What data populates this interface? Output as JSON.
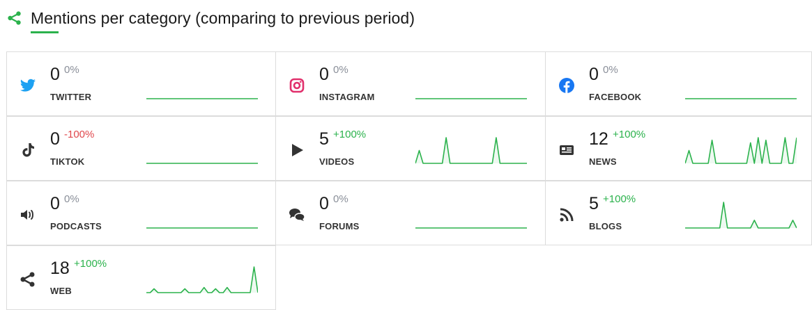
{
  "header": {
    "title": "Mentions per category (comparing to previous period)",
    "icon": "share-icon"
  },
  "colors": {
    "accent": "#2bb24c",
    "negative": "#e0474c",
    "neutral": "#8a8f99",
    "twitter": "#1da1f2",
    "instagram": "#e1306c",
    "facebook": "#1877f2",
    "icon_dark": "#333333"
  },
  "categories": [
    {
      "label": "TWITTER",
      "count": "0",
      "change": "0%",
      "trend": "neutral",
      "icon": "twitter-icon",
      "series": [
        0,
        0,
        0,
        0,
        0,
        0,
        0,
        0,
        0,
        0,
        0,
        0,
        0,
        0,
        0,
        0,
        0,
        0,
        0,
        0,
        0,
        0,
        0,
        0,
        0,
        0,
        0,
        0,
        0,
        0
      ]
    },
    {
      "label": "INSTAGRAM",
      "count": "0",
      "change": "0%",
      "trend": "neutral",
      "icon": "instagram-icon",
      "series": [
        0,
        0,
        0,
        0,
        0,
        0,
        0,
        0,
        0,
        0,
        0,
        0,
        0,
        0,
        0,
        0,
        0,
        0,
        0,
        0,
        0,
        0,
        0,
        0,
        0,
        0,
        0,
        0,
        0,
        0
      ]
    },
    {
      "label": "FACEBOOK",
      "count": "0",
      "change": "0%",
      "trend": "neutral",
      "icon": "facebook-icon",
      "series": [
        0,
        0,
        0,
        0,
        0,
        0,
        0,
        0,
        0,
        0,
        0,
        0,
        0,
        0,
        0,
        0,
        0,
        0,
        0,
        0,
        0,
        0,
        0,
        0,
        0,
        0,
        0,
        0,
        0,
        0
      ]
    },
    {
      "label": "TIKTOK",
      "count": "0",
      "change": "-100%",
      "trend": "neg",
      "icon": "tiktok-icon",
      "series": [
        0,
        0,
        0,
        0,
        0,
        0,
        0,
        0,
        0,
        0,
        0,
        0,
        0,
        0,
        0,
        0,
        0,
        0,
        0,
        0,
        0,
        0,
        0,
        0,
        0,
        0,
        0,
        0,
        0,
        0
      ]
    },
    {
      "label": "VIDEOS",
      "count": "5",
      "change": "+100%",
      "trend": "pos",
      "icon": "play-icon",
      "series": [
        0,
        0.5,
        0,
        0,
        0,
        0,
        0,
        0,
        1,
        0,
        0,
        0,
        0,
        0,
        0,
        0,
        0,
        0,
        0,
        0,
        0,
        1,
        0,
        0,
        0,
        0,
        0,
        0,
        0,
        0
      ]
    },
    {
      "label": "NEWS",
      "count": "12",
      "change": "+100%",
      "trend": "pos",
      "icon": "newspaper-icon",
      "series": [
        0,
        0.5,
        0,
        0,
        0,
        0,
        0,
        0.9,
        0,
        0,
        0,
        0,
        0,
        0,
        0,
        0,
        0,
        0.8,
        0,
        1,
        0,
        0.9,
        0,
        0,
        0,
        0,
        1,
        0,
        0,
        1
      ]
    },
    {
      "label": "PODCASTS",
      "count": "0",
      "change": "0%",
      "trend": "neutral",
      "icon": "speaker-icon",
      "series": [
        0,
        0,
        0,
        0,
        0,
        0,
        0,
        0,
        0,
        0,
        0,
        0,
        0,
        0,
        0,
        0,
        0,
        0,
        0,
        0,
        0,
        0,
        0,
        0,
        0,
        0,
        0,
        0,
        0,
        0
      ]
    },
    {
      "label": "FORUMS",
      "count": "0",
      "change": "0%",
      "trend": "neutral",
      "icon": "chat-icon",
      "series": [
        0,
        0,
        0,
        0,
        0,
        0,
        0,
        0,
        0,
        0,
        0,
        0,
        0,
        0,
        0,
        0,
        0,
        0,
        0,
        0,
        0,
        0,
        0,
        0,
        0,
        0,
        0,
        0,
        0,
        0
      ]
    },
    {
      "label": "BLOGS",
      "count": "5",
      "change": "+100%",
      "trend": "pos",
      "icon": "rss-icon",
      "series": [
        0,
        0,
        0,
        0,
        0,
        0,
        0,
        0,
        0,
        0,
        1,
        0,
        0,
        0,
        0,
        0,
        0,
        0,
        0.3,
        0,
        0,
        0,
        0,
        0,
        0,
        0,
        0,
        0,
        0.3,
        0
      ]
    },
    {
      "label": "WEB",
      "count": "18",
      "change": "+100%",
      "trend": "pos",
      "icon": "share-icon",
      "series": [
        0,
        0,
        0.15,
        0,
        0,
        0,
        0,
        0,
        0,
        0,
        0.15,
        0,
        0,
        0,
        0,
        0.2,
        0,
        0,
        0.15,
        0,
        0,
        0.2,
        0,
        0,
        0,
        0,
        0,
        0,
        1,
        0
      ]
    }
  ]
}
